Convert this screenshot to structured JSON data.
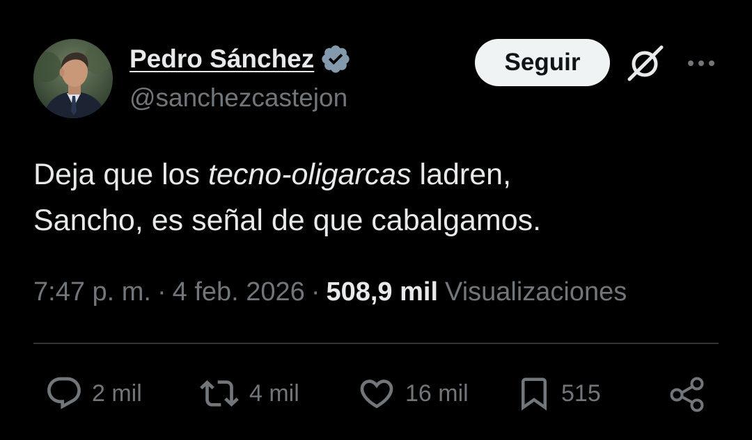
{
  "author": {
    "display_name": "Pedro Sánchez",
    "handle": "@sanchezcastejon",
    "verified": true,
    "verified_badge_icon": "verified-badge-icon",
    "avatar_icon": "user-avatar"
  },
  "header": {
    "follow_label": "Seguir",
    "grok_icon": "grok-icon",
    "more_icon": "more-options-icon"
  },
  "tweet": {
    "text_part1": "Deja que los ",
    "text_italic": "tecno-oligarcas",
    "text_part2": " ladren,",
    "text_line2": "Sancho, es señal de que cabalgamos."
  },
  "meta": {
    "time": "7:47 p. m.",
    "separator1": "·",
    "date": "4 feb. 2026",
    "separator2": "·",
    "views_count": "508,9 mil",
    "views_label": "Visualizaciones"
  },
  "actions": {
    "replies": "2 mil",
    "retweets": "4 mil",
    "likes": "16 mil",
    "bookmarks": "515",
    "reply_icon": "reply-icon",
    "retweet_icon": "retweet-icon",
    "like_icon": "heart-icon",
    "bookmark_icon": "bookmark-icon",
    "share_icon": "share-icon"
  },
  "colors": {
    "background": "#000000",
    "primary_text": "#e7e9ea",
    "secondary_text": "#71767b",
    "verified_badge": "#829aab",
    "follow_button_bg": "#eff3f4",
    "divider": "#2f3336"
  }
}
